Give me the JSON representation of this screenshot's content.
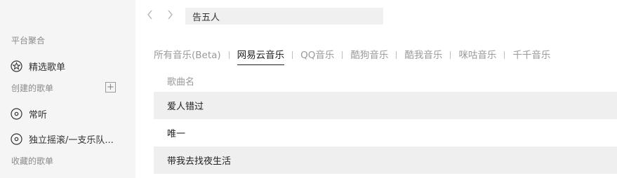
{
  "sidebar": {
    "section_platform": "平台聚合",
    "featured": {
      "label": "精选歌单",
      "icon": "star-circle-icon"
    },
    "section_created": "创建的歌单",
    "add_icon": "plus-square-icon",
    "created_items": [
      {
        "label": "常听",
        "icon": "disc-icon"
      },
      {
        "label": "独立摇滚/一支乐队...",
        "icon": "disc-icon"
      }
    ],
    "section_favorites": "收藏的歌单"
  },
  "topbar": {
    "back_icon": "chevron-left-icon",
    "forward_icon": "chevron-right-icon",
    "search_value": "告五人"
  },
  "tabs": [
    {
      "label": "所有音乐(Beta)",
      "active": false
    },
    {
      "label": "网易云音乐",
      "active": true
    },
    {
      "label": "QQ音乐",
      "active": false
    },
    {
      "label": "酷狗音乐",
      "active": false
    },
    {
      "label": "酷我音乐",
      "active": false
    },
    {
      "label": "咪咕音乐",
      "active": false
    },
    {
      "label": "千千音乐",
      "active": false
    }
  ],
  "song_list": {
    "column_header": "歌曲名",
    "rows": [
      {
        "title": "爱人错过"
      },
      {
        "title": "唯一"
      },
      {
        "title": "带我去找夜生活"
      }
    ]
  }
}
